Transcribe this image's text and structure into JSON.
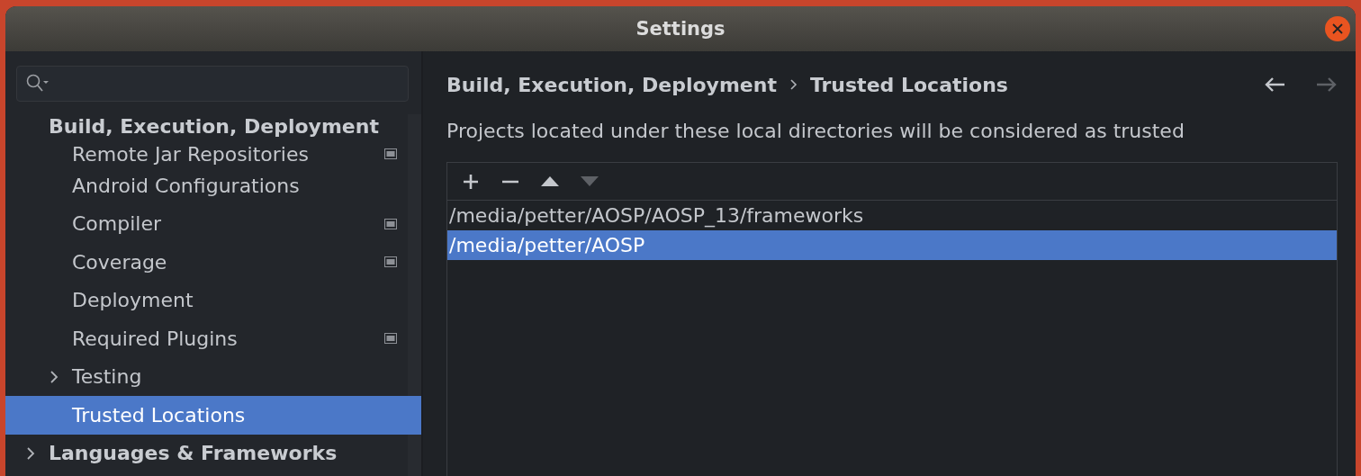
{
  "window": {
    "title": "Settings"
  },
  "sidebar": {
    "section": "Build, Execution, Deployment",
    "items": [
      {
        "label": "Remote Jar Repositories",
        "project_level": true,
        "selected": false
      },
      {
        "label": "Android Configurations",
        "project_level": false,
        "selected": false
      },
      {
        "label": "Compiler",
        "project_level": true,
        "selected": false
      },
      {
        "label": "Coverage",
        "project_level": true,
        "selected": false
      },
      {
        "label": "Deployment",
        "project_level": false,
        "selected": false
      },
      {
        "label": "Required Plugins",
        "project_level": true,
        "selected": false
      },
      {
        "label": "Testing",
        "project_level": false,
        "selected": false,
        "expanded": false
      },
      {
        "label": "Trusted Locations",
        "project_level": false,
        "selected": true
      }
    ],
    "next_section": {
      "label": "Languages & Frameworks",
      "expanded": false
    }
  },
  "breadcrumb": [
    "Build, Execution, Deployment",
    "Trusted Locations"
  ],
  "nav": {
    "back_disabled": false,
    "forward_disabled": true
  },
  "description": "Projects located under these local directories will be considered as trusted",
  "toolbar": [
    {
      "kind": "add",
      "disabled": false
    },
    {
      "kind": "remove",
      "disabled": false
    },
    {
      "kind": "up",
      "disabled": false
    },
    {
      "kind": "down",
      "disabled": true
    }
  ],
  "locations": [
    {
      "path": "/media/petter/AOSP/AOSP_13/frameworks",
      "selected": false
    },
    {
      "path": "/media/petter/AOSP",
      "selected": true
    }
  ]
}
